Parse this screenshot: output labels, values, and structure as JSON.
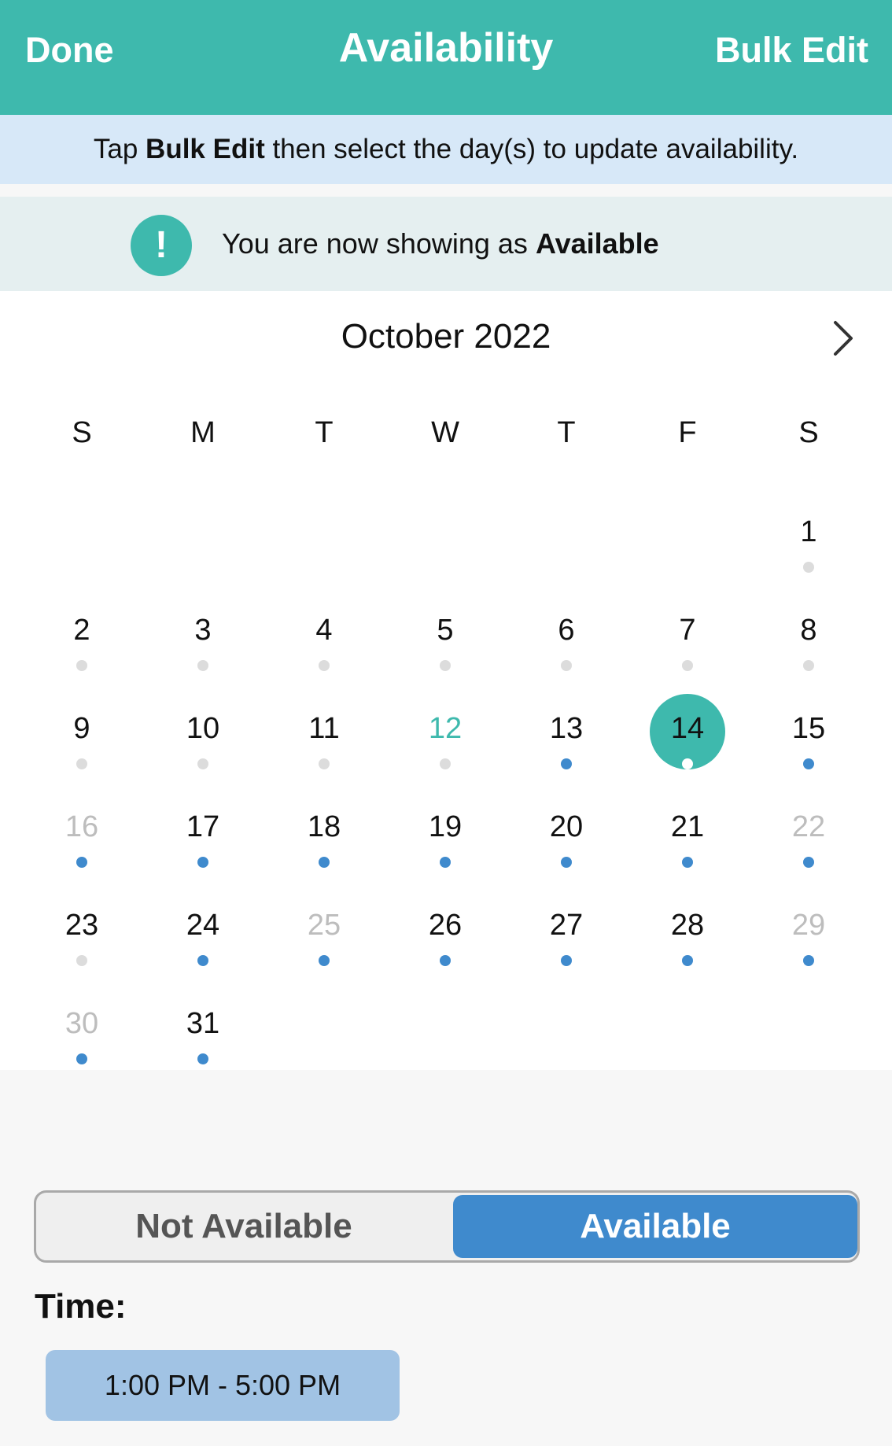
{
  "header": {
    "done_label": "Done",
    "title": "Availability",
    "bulk_edit_label": "Bulk Edit"
  },
  "info_banner": {
    "prefix": "Tap ",
    "bold": "Bulk Edit",
    "suffix": " then select the day(s) to update availability."
  },
  "status": {
    "icon_glyph": "!",
    "prefix": "You are now showing as ",
    "bold": "Available"
  },
  "calendar": {
    "month_label": "October 2022",
    "weekdays": [
      "S",
      "M",
      "T",
      "W",
      "T",
      "F",
      "S"
    ],
    "days": [
      {
        "n": "1",
        "dot": "gray"
      },
      {
        "n": "2",
        "dot": "gray"
      },
      {
        "n": "3",
        "dot": "gray"
      },
      {
        "n": "4",
        "dot": "gray"
      },
      {
        "n": "5",
        "dot": "gray"
      },
      {
        "n": "6",
        "dot": "gray"
      },
      {
        "n": "7",
        "dot": "gray"
      },
      {
        "n": "8",
        "dot": "gray"
      },
      {
        "n": "9",
        "dot": "gray"
      },
      {
        "n": "10",
        "dot": "gray"
      },
      {
        "n": "11",
        "dot": "gray"
      },
      {
        "n": "12",
        "dot": "gray",
        "state": "today"
      },
      {
        "n": "13",
        "dot": "blue"
      },
      {
        "n": "14",
        "dot": "white",
        "state": "selected"
      },
      {
        "n": "15",
        "dot": "blue"
      },
      {
        "n": "16",
        "dot": "blue",
        "state": "faded"
      },
      {
        "n": "17",
        "dot": "blue"
      },
      {
        "n": "18",
        "dot": "blue"
      },
      {
        "n": "19",
        "dot": "blue"
      },
      {
        "n": "20",
        "dot": "blue"
      },
      {
        "n": "21",
        "dot": "blue"
      },
      {
        "n": "22",
        "dot": "blue",
        "state": "faded"
      },
      {
        "n": "23",
        "dot": "gray"
      },
      {
        "n": "24",
        "dot": "blue"
      },
      {
        "n": "25",
        "dot": "blue",
        "state": "faded"
      },
      {
        "n": "26",
        "dot": "blue"
      },
      {
        "n": "27",
        "dot": "blue"
      },
      {
        "n": "28",
        "dot": "blue"
      },
      {
        "n": "29",
        "dot": "blue",
        "state": "faded"
      },
      {
        "n": "30",
        "dot": "blue",
        "state": "faded"
      },
      {
        "n": "31",
        "dot": "blue"
      }
    ]
  },
  "availability_toggle": {
    "not_available_label": "Not Available",
    "available_label": "Available",
    "selected": "Available"
  },
  "time": {
    "label": "Time:",
    "range": "1:00 PM - 5:00 PM"
  },
  "colors": {
    "header": "#3eb9ad",
    "accent_blue": "#3f8acd",
    "info_banner": "#d7e8f8",
    "status_bar": "#e5eff0"
  }
}
